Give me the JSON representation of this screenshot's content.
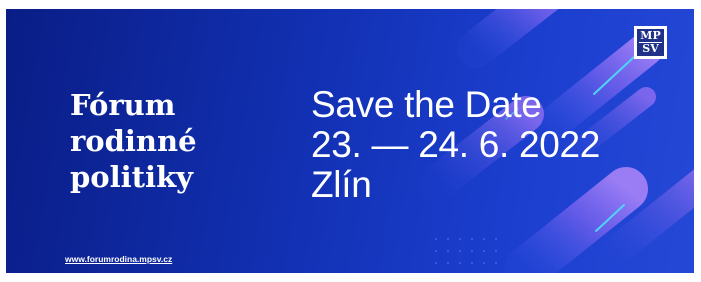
{
  "banner": {
    "title_lines": [
      "Fórum",
      "rodinné",
      "politiky"
    ],
    "save_lines": [
      "Save the Date",
      "23. — 24. 6. 2022",
      "Zlín"
    ],
    "url": "www.forumrodina.mpsv.cz",
    "logo_lines": [
      "MP",
      "SV"
    ]
  },
  "colors": {
    "background_dark": "#0a1d86",
    "background_light": "#2548d6",
    "accent_purple": "#8a6cf0",
    "accent_cyan": "#4fd3ff",
    "text": "#ffffff"
  }
}
